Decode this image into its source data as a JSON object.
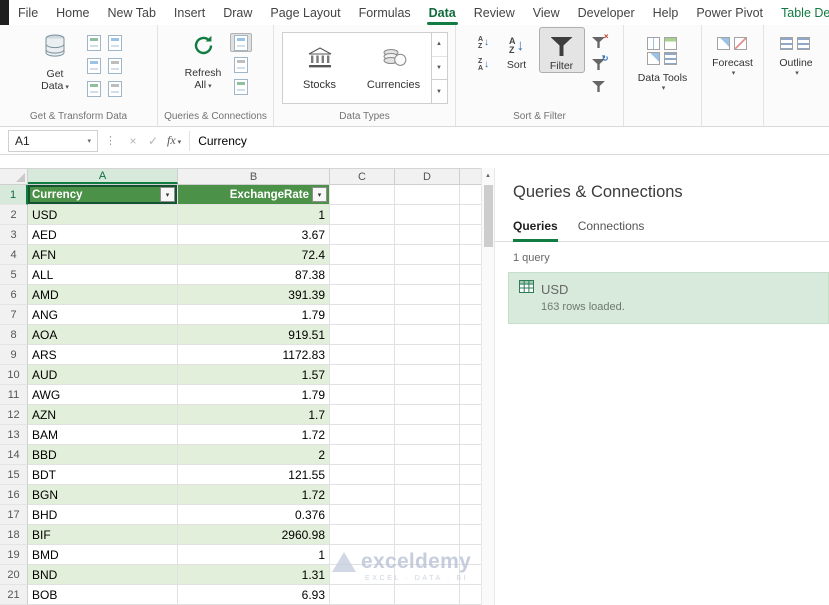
{
  "window": {
    "tabs": [
      {
        "label": "File",
        "state": ""
      },
      {
        "label": "Home",
        "state": ""
      },
      {
        "label": "New Tab",
        "state": ""
      },
      {
        "label": "Insert",
        "state": ""
      },
      {
        "label": "Draw",
        "state": ""
      },
      {
        "label": "Page Layout",
        "state": ""
      },
      {
        "label": "Formulas",
        "state": ""
      },
      {
        "label": "Data",
        "state": "active"
      },
      {
        "label": "Review",
        "state": ""
      },
      {
        "label": "View",
        "state": ""
      },
      {
        "label": "Developer",
        "state": ""
      },
      {
        "label": "Help",
        "state": ""
      },
      {
        "label": "Power Pivot",
        "state": ""
      },
      {
        "label": "Table Design",
        "state": "contextual"
      }
    ]
  },
  "ribbon": {
    "group_labels": [
      "Get & Transform Data",
      "Queries & Connections",
      "Data Types",
      "Sort & Filter"
    ],
    "get_data_label": "Get Data",
    "refresh_all_label": "Refresh All",
    "data_types_items": [
      "Stocks",
      "Currencies"
    ],
    "sort_label": "Sort",
    "filter_label": "Filter",
    "data_tools_label": "Data Tools",
    "forecast_label": "Forecast",
    "outline_label": "Outline"
  },
  "formula_bar": {
    "name_box": "A1",
    "fx_label": "fx",
    "formula": "Currency"
  },
  "sheet": {
    "columns": [
      "A",
      "B",
      "C",
      "D"
    ],
    "table_headers": [
      "Currency",
      "ExchangeRate"
    ],
    "rows": [
      {
        "n": 2,
        "code": "USD",
        "rate": "1"
      },
      {
        "n": 3,
        "code": "AED",
        "rate": "3.67"
      },
      {
        "n": 4,
        "code": "AFN",
        "rate": "72.4"
      },
      {
        "n": 5,
        "code": "ALL",
        "rate": "87.38"
      },
      {
        "n": 6,
        "code": "AMD",
        "rate": "391.39"
      },
      {
        "n": 7,
        "code": "ANG",
        "rate": "1.79"
      },
      {
        "n": 8,
        "code": "AOA",
        "rate": "919.51"
      },
      {
        "n": 9,
        "code": "ARS",
        "rate": "1172.83"
      },
      {
        "n": 10,
        "code": "AUD",
        "rate": "1.57"
      },
      {
        "n": 11,
        "code": "AWG",
        "rate": "1.79"
      },
      {
        "n": 12,
        "code": "AZN",
        "rate": "1.7"
      },
      {
        "n": 13,
        "code": "BAM",
        "rate": "1.72"
      },
      {
        "n": 14,
        "code": "BBD",
        "rate": "2"
      },
      {
        "n": 15,
        "code": "BDT",
        "rate": "121.55"
      },
      {
        "n": 16,
        "code": "BGN",
        "rate": "1.72"
      },
      {
        "n": 17,
        "code": "BHD",
        "rate": "0.376"
      },
      {
        "n": 18,
        "code": "BIF",
        "rate": "2960.98"
      },
      {
        "n": 19,
        "code": "BMD",
        "rate": "1"
      },
      {
        "n": 20,
        "code": "BND",
        "rate": "1.31"
      },
      {
        "n": 21,
        "code": "BOB",
        "rate": "6.93"
      }
    ]
  },
  "panel": {
    "title": "Queries & Connections",
    "tabs": [
      {
        "label": "Queries",
        "state": "active"
      },
      {
        "label": "Connections",
        "state": ""
      }
    ],
    "count": "1 query",
    "query": {
      "name": "USD",
      "status": "163 rows loaded."
    }
  },
  "watermark": {
    "title": "exceldemy",
    "subtitle": "EXCEL · DATA · BI"
  }
}
